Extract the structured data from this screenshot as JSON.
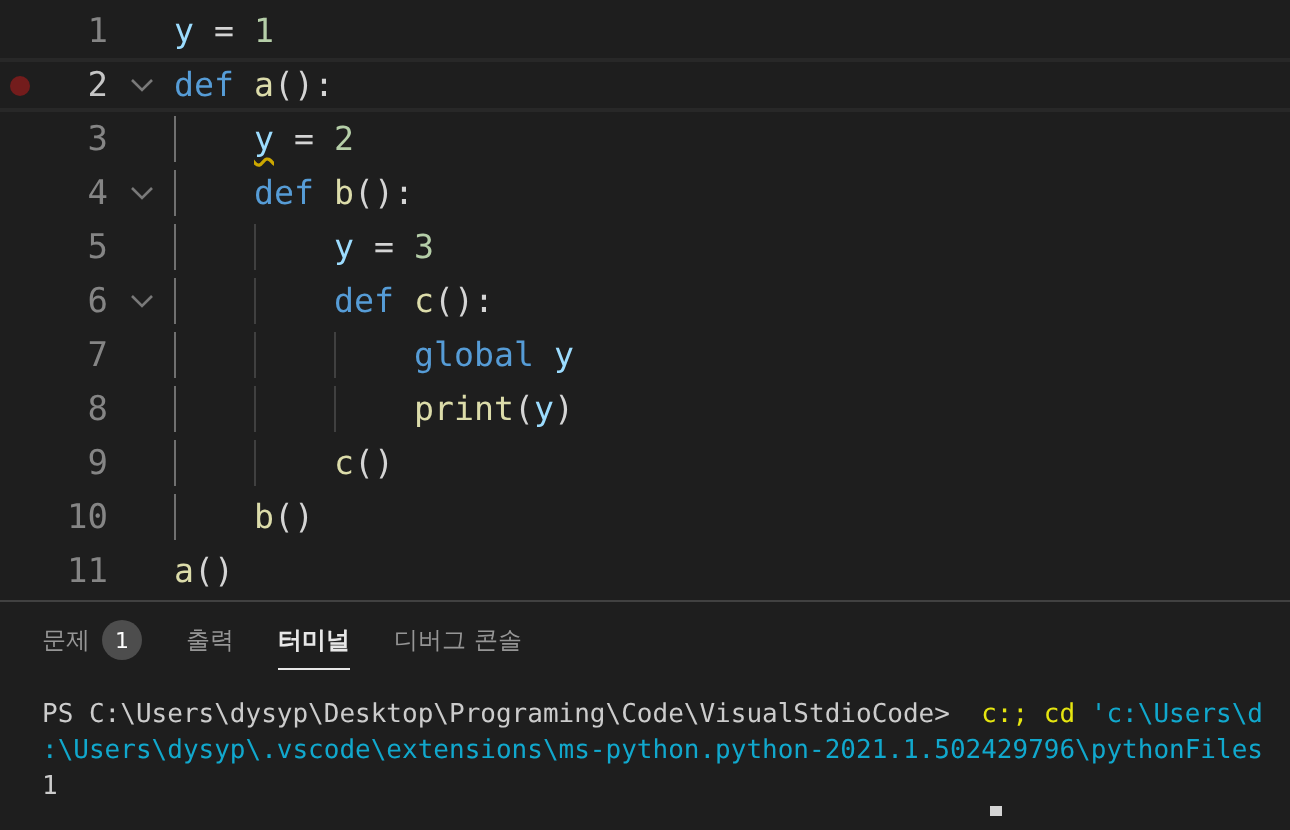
{
  "editor": {
    "lines": [
      {
        "number": "1",
        "breakpoint": false,
        "current": false,
        "tokens": [
          {
            "kind": "var",
            "text": "y",
            "warning": false
          },
          {
            "kind": "op",
            "text": " = ",
            "warning": false
          },
          {
            "kind": "num",
            "text": "1",
            "warning": false
          }
        ]
      },
      {
        "number": "2",
        "breakpoint": true,
        "current": true,
        "expanded": true,
        "tokens": [
          {
            "kind": "kw",
            "text": "def ",
            "warning": false
          },
          {
            "kind": "fn",
            "text": "a",
            "warning": false
          },
          {
            "kind": "op",
            "text": "():",
            "warning": false
          }
        ],
        "children": [
          {
            "number": "3",
            "breakpoint": false,
            "current": false,
            "tokens": [
              {
                "kind": "var",
                "text": "y",
                "warning": true
              },
              {
                "kind": "op",
                "text": " = ",
                "warning": false
              },
              {
                "kind": "num",
                "text": "2",
                "warning": false
              }
            ]
          },
          {
            "number": "4",
            "breakpoint": false,
            "current": false,
            "expanded": true,
            "tokens": [
              {
                "kind": "kw",
                "text": "def ",
                "warning": false
              },
              {
                "kind": "fn",
                "text": "b",
                "warning": false
              },
              {
                "kind": "op",
                "text": "():",
                "warning": false
              }
            ],
            "children": [
              {
                "number": "5",
                "breakpoint": false,
                "current": false,
                "tokens": [
                  {
                    "kind": "var",
                    "text": "y",
                    "warning": false
                  },
                  {
                    "kind": "op",
                    "text": " = ",
                    "warning": false
                  },
                  {
                    "kind": "num",
                    "text": "3",
                    "warning": false
                  }
                ]
              },
              {
                "number": "6",
                "breakpoint": false,
                "current": false,
                "expanded": true,
                "tokens": [
                  {
                    "kind": "kw",
                    "text": "def ",
                    "warning": false
                  },
                  {
                    "kind": "fn",
                    "text": "c",
                    "warning": false
                  },
                  {
                    "kind": "op",
                    "text": "():",
                    "warning": false
                  }
                ],
                "children": [
                  {
                    "number": "7",
                    "breakpoint": false,
                    "current": false,
                    "tokens": [
                      {
                        "kind": "kw",
                        "text": "global ",
                        "warning": false
                      },
                      {
                        "kind": "var",
                        "text": "y",
                        "warning": false
                      }
                    ]
                  },
                  {
                    "number": "8",
                    "breakpoint": false,
                    "current": false,
                    "tokens": [
                      {
                        "kind": "fn",
                        "text": "print",
                        "warning": false
                      },
                      {
                        "kind": "op",
                        "text": "(",
                        "warning": false
                      },
                      {
                        "kind": "var",
                        "text": "y",
                        "warning": false
                      },
                      {
                        "kind": "op",
                        "text": ")",
                        "warning": false
                      }
                    ]
                  }
                ]
              },
              {
                "number": "9",
                "breakpoint": false,
                "current": false,
                "tokens": [
                  {
                    "kind": "fn",
                    "text": "c",
                    "warning": false
                  },
                  {
                    "kind": "op",
                    "text": "()",
                    "warning": false
                  }
                ]
              }
            ]
          },
          {
            "number": "10",
            "breakpoint": false,
            "current": false,
            "tokens": [
              {
                "kind": "fn",
                "text": "b",
                "warning": false
              },
              {
                "kind": "op",
                "text": "()",
                "warning": false
              }
            ]
          }
        ]
      },
      {
        "number": "11",
        "breakpoint": false,
        "current": false,
        "tokens": [
          {
            "kind": "fn",
            "text": "a",
            "warning": false
          },
          {
            "kind": "op",
            "text": "()",
            "warning": false
          }
        ]
      }
    ]
  },
  "panel": {
    "tabs": [
      {
        "label": "문제",
        "badge": "1",
        "selected": false
      },
      {
        "label": "출력",
        "selected": false
      },
      {
        "label": "터미널",
        "selected": true
      },
      {
        "label": "디버그 콘솔",
        "selected": false
      }
    ],
    "terminal": [
      [
        {
          "kind": "plain",
          "text": "PS C:\\Users\\dysyp\\Desktop\\Programing\\Code\\VisualStdioCode>  "
        },
        {
          "kind": "cmd",
          "text": "c:; "
        },
        {
          "kind": "cmd",
          "text": "cd "
        },
        {
          "kind": "str",
          "text": "'c:\\Users\\d"
        }
      ],
      [
        {
          "kind": "str",
          "text": ":\\Users\\dysyp\\.vscode\\extensions\\ms-python.python-2021.1.502429796\\pythonFiles"
        }
      ],
      [
        {
          "kind": "plain",
          "text": "1"
        }
      ]
    ]
  }
}
